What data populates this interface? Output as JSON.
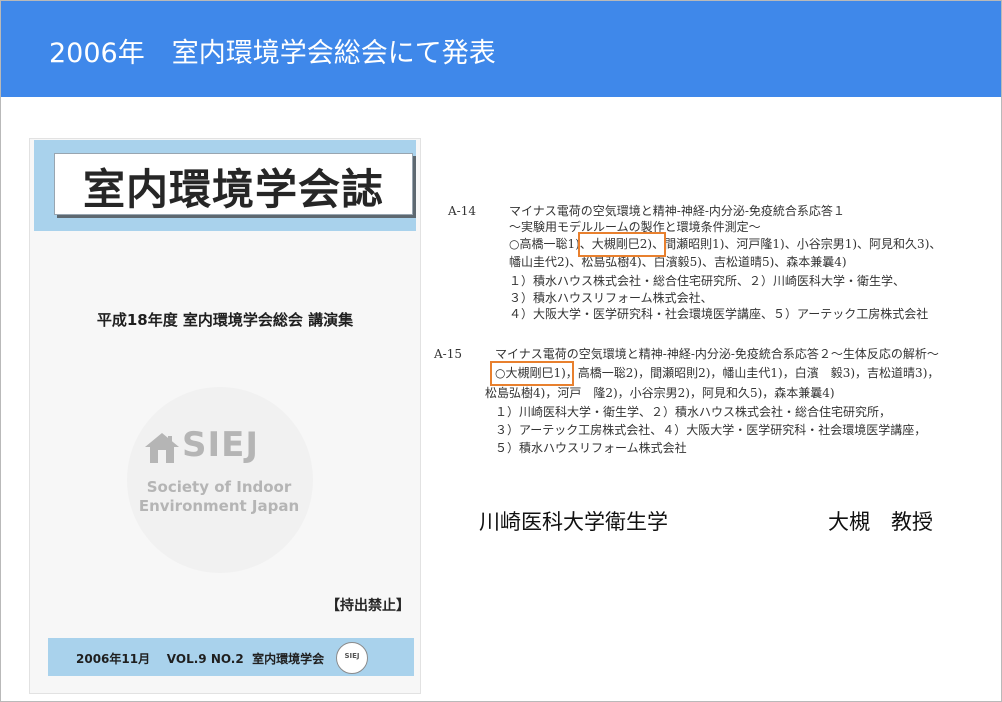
{
  "header": {
    "title": "2006年　室内環境学会総会にて発表"
  },
  "cover": {
    "title": "室内環境学会誌",
    "subtitle": "平成18年度  室内環境学会総会  講演集",
    "logo": {
      "abbr": "SIEJ",
      "line1": "Society of Indoor",
      "line2": "Environment Japan",
      "icon": "house-icon"
    },
    "notice": "【持出禁止】",
    "footer": "2006年11月    VOL.9 NO.2  室内環境学会",
    "seal_text": "SIEJ"
  },
  "abstracts": [
    {
      "code": "A-14",
      "lines": [
        "マイナス電荷の空気環境と精神-神経-内分泌-免疫統合系応答１",
        "～実験用モデルルームの製作と環境条件測定～",
        "○高橋一聡1)、大槻剛巳2)、間瀬昭則1)、河戸隆1)、小谷宗男1)、阿見和久3)、",
        "幡山圭代2)、松島弘樹4)、白濱毅5)、吉松道晴5)、森本兼曩4)",
        "１）積水ハウス株式会社・総合住宅研究所、２）川崎医科大学・衛生学、",
        "３）積水ハウスリフォーム株式会社、",
        "４）大阪大学・医学研究科・社会環境医学講座、５）アーテック工房株式会社"
      ]
    },
    {
      "code": "A-15",
      "lines": [
        "マイナス電荷の空気環境と精神-神経-内分泌-免疫統合系応答２～生体反応の解析～",
        "○大槻剛巳1)，高橋一聡2)，間瀬昭則2)，幡山圭代1)，白濱　毅3)，吉松道晴3)，",
        "松島弘樹4)，河戸　隆2)，小谷宗男2)，阿見和久5)，森本兼曩4)",
        "１）川崎医科大学・衛生学、２）積水ハウス株式会社・総合住宅研究所，",
        "３）アーテック工房株式会社、４）大阪大学・医学研究科・社会環境医学講座，",
        "５）積水ハウスリフォーム株式会社"
      ]
    }
  ],
  "footer": {
    "department": "川崎医科大学衛生学",
    "professor": "大槻　教授"
  },
  "colors": {
    "header": "#3f88ea",
    "cover_band": "#a9d2ec",
    "highlight": "#e8802e"
  }
}
